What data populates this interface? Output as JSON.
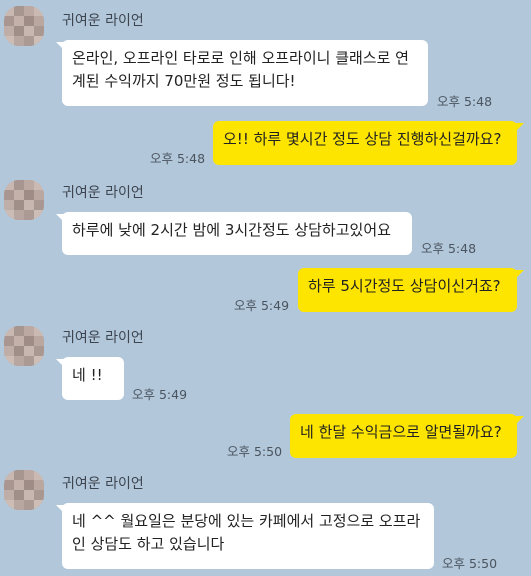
{
  "chat": {
    "contact_name": "귀여운 라이언",
    "messages": [
      {
        "from": "them",
        "text": "온라인, 오프라인 타로로 인해 오프라이니 클래스로 연계된 수익까지 70만원 정도 됩니다!",
        "time": "오후 5:48"
      },
      {
        "from": "me",
        "text": "오!! 하루 몇시간 정도 상담 진행하신걸까요?",
        "time": "오후 5:48"
      },
      {
        "from": "them",
        "text": "하루에 낮에 2시간 밤에 3시간정도 상담하고있어요",
        "time": "오후 5:48"
      },
      {
        "from": "me",
        "text": "하루 5시간정도 상담이신거죠?",
        "time": "오후 5:49"
      },
      {
        "from": "them",
        "text": "네 !!",
        "time": "오후 5:49"
      },
      {
        "from": "me",
        "text": "네 한달 수익금으로 알면될까요?",
        "time": "오후 5:50"
      },
      {
        "from": "them",
        "text": "네 ^^ 월요일은 분당에 있는 카페에서 고정으로 오프라인 상담도 하고 있습니다",
        "time": "오후 5:50"
      }
    ]
  },
  "colors": {
    "background": "#b2c7da",
    "my_bubble": "#fee500",
    "their_bubble": "#ffffff"
  }
}
